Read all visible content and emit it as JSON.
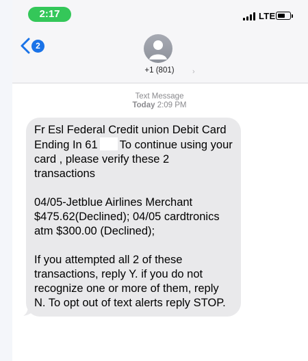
{
  "status_bar": {
    "time": "2:17",
    "network": "LTE",
    "icons": [
      "signal-bars-icon",
      "battery-icon"
    ]
  },
  "header": {
    "back_badge_count": "2",
    "contact_name": "+1 (801)",
    "icons": [
      "back-chevron-icon",
      "contact-avatar-icon",
      "chevron-right-icon"
    ]
  },
  "conversation": {
    "service_label": "Text Message",
    "timestamp_day": "Today",
    "timestamp_time": "2:09 PM"
  },
  "message": {
    "line1_before": "Fr Esl Federal Credit union Debit Card Ending In 61",
    "line1_after": "To continue using your card , please verify these 2 transactions",
    "paragraph2": "04/05-Jetblue Airlines Merchant $475.62(Declined); 04/05 cardtronics atm $300.00 (Declined);",
    "paragraph3": "If you attempted all 2 of these transactions, reply Y. if you do not recognize one or more of them, reply N. To opt out of text alerts reply STOP."
  },
  "colors": {
    "time_pill": "#34c759",
    "badge": "#1a73e8",
    "incoming_bubble": "#e9e9eb",
    "header_bg": "#f6f6f8"
  }
}
